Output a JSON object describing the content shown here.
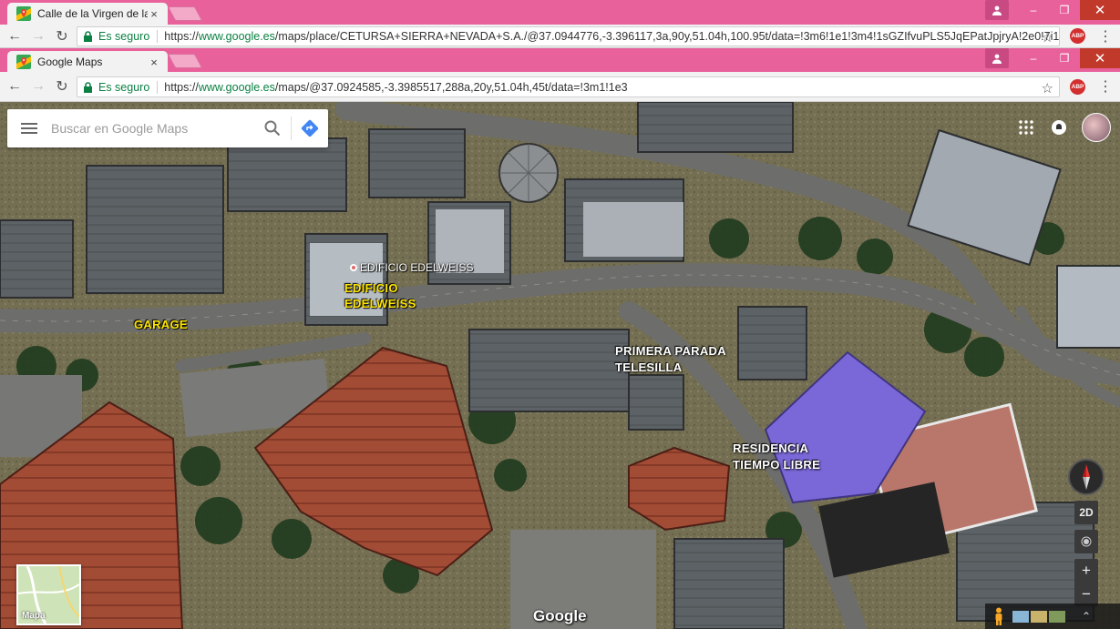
{
  "window_back": {
    "tab_title": "Calle de la Virgen de las",
    "tab_close": "×",
    "secure_label": "Es seguro",
    "url_scheme": "https://",
    "url_host": "www.google.es",
    "url_path": "/maps/place/CETURSA+SIERRA+NEVADA+S.A./@37.0944776,-3.396117,3a,90y,51.04h,100.95t/data=!3m6!1e1!3m4!1sGZIfvuPLS5JqEPatJpjryA!2e0!7i13"
  },
  "window_front": {
    "tab_title": "Google Maps",
    "tab_close": "×",
    "secure_label": "Es seguro",
    "url_scheme": "https://",
    "url_host": "www.google.es",
    "url_path": "/maps/@37.0924585,-3.3985517,288a,20y,51.04h,45t/data=!3m1!1e3"
  },
  "window_controls": {
    "minimize": "–",
    "restore": "❐",
    "close": "✕"
  },
  "extension": {
    "abp_label": "ABP"
  },
  "map": {
    "search": {
      "placeholder": "Buscar en Google Maps"
    },
    "place_label": "EDIFICIO EDELWEISS",
    "annotations": {
      "edificio": [
        "EDIFICIO",
        "EDELWEISS"
      ],
      "garage": "GARAGE",
      "telesilla": [
        "PRIMERA PARADA",
        "TELESILLA"
      ],
      "residencia": [
        "RESIDENCIA",
        "TIEMPO LIBRE"
      ]
    },
    "minimap_label": "Mapa",
    "google_logo": "Google",
    "view_toggle": "2D",
    "zoom_in": "+",
    "zoom_out": "−",
    "expand_chevron": "⌃"
  },
  "colors": {
    "tabstrip": "#e9619b",
    "secure_green": "#0b8043",
    "annotation_yellow": "#ffe600"
  }
}
